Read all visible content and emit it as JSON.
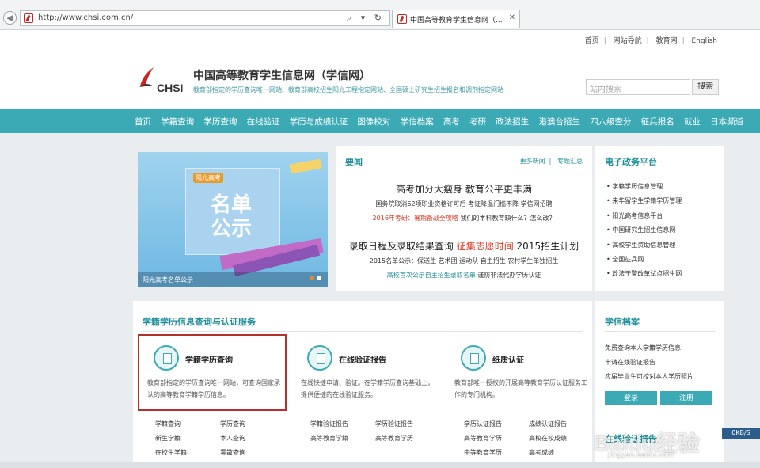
{
  "browser": {
    "url": "http://www.chsi.com.cn/",
    "address_controls": "⌕ ▾ ↻",
    "tab_title": "中国高等教育学生信息网（...",
    "tab_close": "✕"
  },
  "topbar": [
    "首页",
    "网站导航",
    "教育网",
    "English"
  ],
  "header": {
    "logo_text": "CHSI",
    "title": "中国高等教育学生信息网（学信网）",
    "subtitle": "教育部指定的学历查询唯一网站、教育部高校招生阳光工程指定网站、全国硕士研究生招生报名和调剂指定网站",
    "search_placeholder": "站内搜索",
    "search_button": "搜索"
  },
  "nav": [
    "首页",
    "学籍查询",
    "学历查询",
    "在线验证",
    "学历与成绩认证",
    "图像校对",
    "学信档案",
    "高考",
    "考研",
    "政法招生",
    "港澳台招生",
    "四六级查分",
    "征兵报名",
    "就业",
    "日本频道"
  ],
  "banner": {
    "badge": "阳光高考",
    "title": "名单公示",
    "caption": "阳光高考名单公示"
  },
  "news": {
    "title": "要闻",
    "more": "更多新闻",
    "special": "专题汇总",
    "headline1": "高考加分大瘦身 教育公平更丰满",
    "sub1": "国务院取消62项职业资格许可后 考证降温门槛不降 学信网招聘",
    "sub2_red": "2016年考研：暑期备战全攻略",
    "sub2_rest": " 我们的本科教育缺什么？怎么改？",
    "headline2_a": "录取日程及录取结果查询 ",
    "headline2_red": "征集志愿时间",
    "headline2_b": " 2015招生计划",
    "sub3": "2015名单公示：保送生 艺术团 运动队 自主招生 农村学生单独招生",
    "sub4_teal": "高校首次公示自主招生录取名单",
    "sub4_rest": " 谨防非法代办学历认证"
  },
  "gov": {
    "title": "电子政务平台",
    "items": [
      "学籍学历信息管理",
      "来华留学生学籍学历管理",
      "阳光高考信息平台",
      "中国研究生招生信息网",
      "高校学生资助信息管理",
      "全国征兵网",
      "政法干警改革试点招生网"
    ]
  },
  "services": {
    "title": "学籍学历信息查询与认证服务",
    "cards": [
      {
        "title": "学籍学历查询",
        "desc": "教育部指定的学历查询唯一网站，可查询国家承认的高等教育学籍学历信息。"
      },
      {
        "title": "在线验证报告",
        "desc": "在线快捷申请、验证。在学籍学历查询基础上，提供便捷的在线验证服务。"
      },
      {
        "title": "纸质认证",
        "desc": "教育部唯一授权的开展高等教育学历认证服务工作的专门机构。"
      }
    ],
    "links": [
      [
        "学籍查询",
        "学历查询",
        "新生学籍",
        "本人查询",
        "在校生学籍",
        "零散查询"
      ],
      [
        "学籍验证报告",
        "学历验证报告",
        "高等教育学籍",
        "高等教育学历"
      ],
      [
        "学历认证报告",
        "成绩认证报告",
        "高等教育学历",
        "高校在校成绩",
        "中等教育学历",
        "高考成绩"
      ]
    ]
  },
  "archive": {
    "title": "学信档案",
    "items": [
      "免费查询本人学籍学历信息",
      "申请在线验证报告",
      "应届毕业生可校对本人学历照片"
    ],
    "login": "登录",
    "register": "注册",
    "title2": "在线验证报告"
  },
  "overlay": {
    "watermark": "Baidu经验",
    "watermark_sub": "jingyan.baidu.com",
    "speed": "0KB/S"
  }
}
